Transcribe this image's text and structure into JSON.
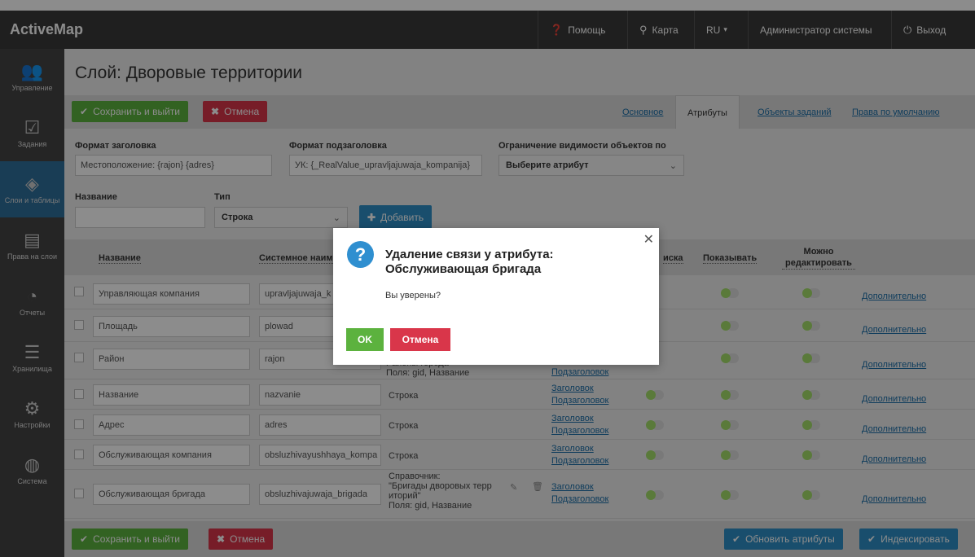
{
  "app": {
    "brand": "ActiveMap"
  },
  "nav": {
    "help": "Помощь",
    "map": "Карта",
    "lang": "RU",
    "user": "Администратор системы",
    "logout": "Выход"
  },
  "sidebar": {
    "items": [
      {
        "label": "Управление",
        "icon": "users-icon"
      },
      {
        "label": "Задания",
        "icon": "checkbox-icon"
      },
      {
        "label": "Слои и таблицы",
        "icon": "layers-icon"
      },
      {
        "label": "Права на слои",
        "icon": "list-icon"
      },
      {
        "label": "Отчеты",
        "icon": "pie-chart-icon"
      },
      {
        "label": "Хранилища",
        "icon": "database-icon"
      },
      {
        "label": "Настройки",
        "icon": "gears-icon"
      },
      {
        "label": "Система",
        "icon": "globe-icon"
      }
    ]
  },
  "page": {
    "title": "Слой: Дворовые территории"
  },
  "toolbar": {
    "save": "Сохранить и выйти",
    "cancel": "Отмена",
    "tabs": [
      "Основное",
      "Атрибуты",
      "Объекты заданий",
      "Права по умолчанию"
    ]
  },
  "form": {
    "title_format_label": "Формат заголовка",
    "title_format_value": "Местоположение: {rajon} {adres}",
    "subtitle_format_label": "Формат подзаголовка",
    "subtitle_format_value": "УК: {_RealValue_upravljajuwaja_kompanija}",
    "visibility_label": "Ограничение видимости объектов по",
    "visibility_value": "Выберите атрибут",
    "name_label": "Название",
    "type_label": "Тип",
    "type_value": "Строка",
    "add": "Добавить"
  },
  "table": {
    "headers": {
      "name": "Название",
      "system_name": "Системное наим",
      "search": "иска",
      "show": "Показывать",
      "editable": "Можно редактировать"
    },
    "more": "Дополнительно",
    "title_link": "Заголовок",
    "subtitle_link": "Подзаголовок",
    "rows": [
      {
        "name": "Управляющая компания",
        "system": "upravljajuwaja_k",
        "type": ""
      },
      {
        "name": "Площадь",
        "system": "plowad",
        "type": ""
      },
      {
        "name": "Район",
        "system": "rajon",
        "type": "Районы города\nПоля: gid, Название"
      },
      {
        "name": "Название",
        "system": "nazvanie",
        "type": "Строка"
      },
      {
        "name": "Адрес",
        "system": "adres",
        "type": "Строка"
      },
      {
        "name": "Обслуживающая компания",
        "system": "obsluzhivayushhaya_kompa",
        "type": "Строка"
      },
      {
        "name": "Обслуживающая бригада",
        "system": "obsluzhivajuwaja_brigada",
        "type": "Справочник:\n\"Бригады дворовых терр\nиторий\"\nПоля: gid, Название"
      }
    ]
  },
  "footer": {
    "save": "Сохранить и выйти",
    "cancel": "Отмена",
    "update_attrs": "Обновить атрибуты",
    "index": "Индексировать"
  },
  "modal": {
    "title": "Удаление связи у атрибута: Обслуживающая бригада",
    "text": "Вы уверены?",
    "ok": "OK",
    "cancel": "Отмена"
  },
  "colors": {
    "topbar": "#3a3a3a",
    "sidebar": "#444444",
    "sidebar_active": "#2f6f9b",
    "green": "#5cb23e",
    "red": "#d9364a",
    "blue": "#2e8fc6",
    "link": "#1b6ea8"
  }
}
